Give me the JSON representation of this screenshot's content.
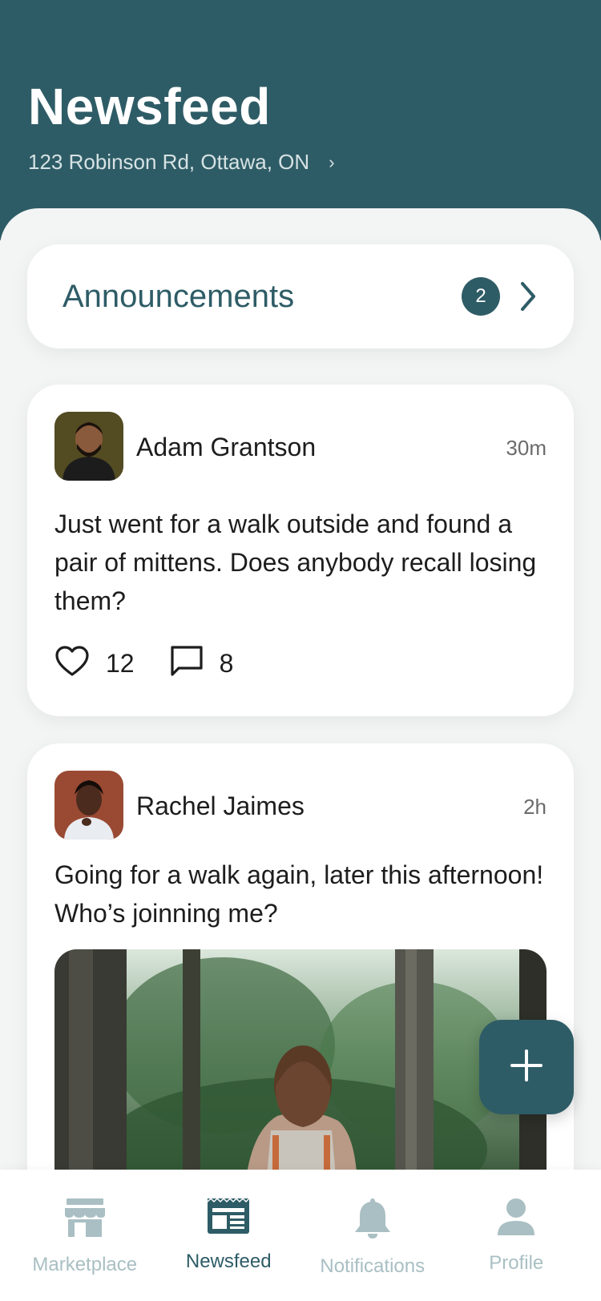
{
  "header": {
    "title": "Newsfeed",
    "address": "123 Robinson Rd, Ottawa, ON",
    "address_chevron": "›"
  },
  "announcements": {
    "label": "Announcements",
    "count": "2",
    "chevron_icon": "chevron-right-icon"
  },
  "posts": [
    {
      "author": "Adam Grantson",
      "time": "30m",
      "text": "Just went for a walk outside and found a pair of mittens. Does anybody recall losing them?",
      "likes": "12",
      "comments": "8"
    },
    {
      "author": "Rachel Jaimes",
      "time": "2h",
      "text": "Going for a walk again, later this afternoon! Who’s joinning me?",
      "image_icon": "forest-photo"
    }
  ],
  "fab": {
    "icon": "plus-icon"
  },
  "bottom_nav": {
    "items": [
      {
        "label": "Marketplace",
        "icon": "store-icon",
        "active": false
      },
      {
        "label": "Newsfeed",
        "icon": "newspaper-icon",
        "active": true
      },
      {
        "label": "Notifications",
        "icon": "bell-icon",
        "active": false
      },
      {
        "label": "Profile",
        "icon": "person-icon",
        "active": false
      }
    ]
  },
  "colors": {
    "primary": "#2e5c66",
    "background": "#f3f4f4",
    "card": "#ffffff",
    "inactive_nav": "#a9bfc3"
  }
}
